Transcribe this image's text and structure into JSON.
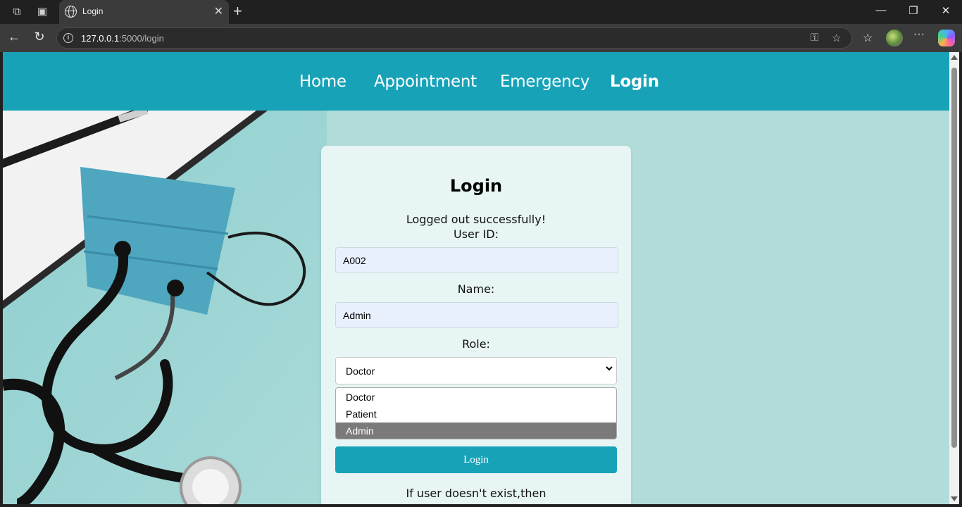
{
  "browser": {
    "tab_title": "Login",
    "url_host": "127.0.0.1",
    "url_path": ":5000/login"
  },
  "nav": {
    "items": [
      {
        "label": "Home"
      },
      {
        "label": "Appointment"
      },
      {
        "label": "Emergency"
      },
      {
        "label": "Login"
      }
    ],
    "active": "Login"
  },
  "form": {
    "title": "Login",
    "flash_message": "Logged out successfully!",
    "user_id_label": "User ID:",
    "user_id_value": "A002",
    "name_label": "Name:",
    "name_value": "Admin",
    "role_label": "Role:",
    "role_value": "Doctor",
    "role_options": [
      "Doctor",
      "Patient",
      "Admin"
    ],
    "highlighted_option": "Admin",
    "submit_label": "Login",
    "footer_text": "If user doesn't exist,then"
  },
  "colors": {
    "nav_bg": "#17a2b8",
    "page_bg": "#b1dcda",
    "button_bg": "#17a2b8"
  }
}
